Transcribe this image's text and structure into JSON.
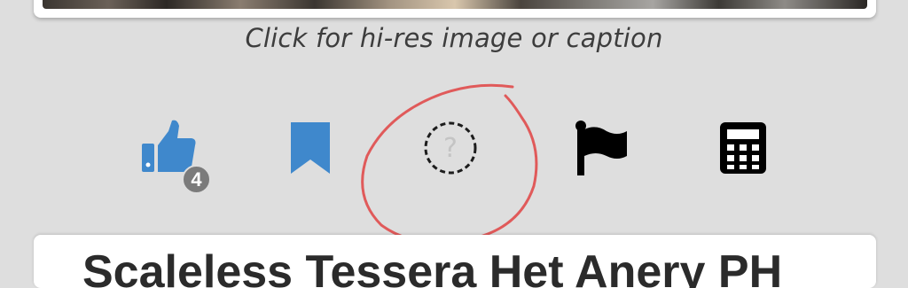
{
  "image": {
    "caption": "Click for hi-res image or caption"
  },
  "actions": {
    "like": {
      "icon": "thumbs-up-icon",
      "count": "4",
      "color": "#3f88cc"
    },
    "bookmark": {
      "icon": "bookmark-icon",
      "color": "#3f88cc"
    },
    "unknown": {
      "icon": "question-mark-icon",
      "glyph": "?"
    },
    "flag": {
      "icon": "flag-icon",
      "color": "#000000"
    },
    "calculator": {
      "icon": "calculator-icon",
      "color": "#000000"
    }
  },
  "annotation": {
    "shape": "hand-drawn-circle",
    "color": "#e05a5a"
  },
  "title": {
    "text": "Scaleless Tessera Het Anery PH"
  }
}
